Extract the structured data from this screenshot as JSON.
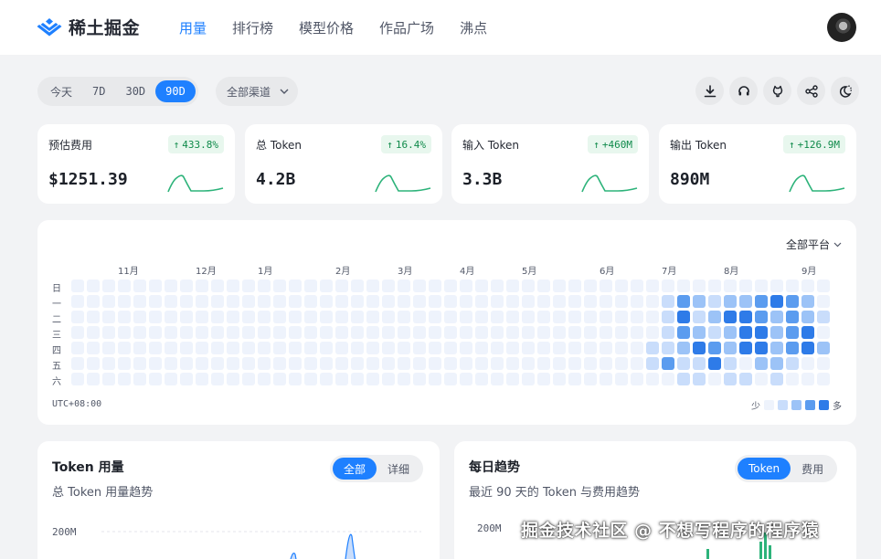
{
  "nav": {
    "brand": "稀土掘金",
    "links": [
      {
        "label": "用量",
        "active": true
      },
      {
        "label": "排行榜",
        "active": false
      },
      {
        "label": "模型价格",
        "active": false
      },
      {
        "label": "作品广场",
        "active": false
      },
      {
        "label": "沸点",
        "active": false
      }
    ],
    "accent_color": "#1e80ff"
  },
  "toolbar": {
    "ranges": [
      {
        "label": "今天",
        "active": false
      },
      {
        "label": "7D",
        "active": false
      },
      {
        "label": "30D",
        "active": false
      },
      {
        "label": "90D",
        "active": true
      }
    ],
    "channel_select": "全部渠道",
    "icons": [
      "download-icon",
      "headset-icon",
      "github-icon",
      "share-icon",
      "theme-toggle-icon"
    ]
  },
  "stats": [
    {
      "label": "预估费用",
      "change": "433.8%",
      "value": "$1251.39"
    },
    {
      "label": "总 Token",
      "change": "16.4%",
      "value": "4.2B"
    },
    {
      "label": "输入 Token",
      "change": "+460M",
      "value": "3.3B"
    },
    {
      "label": "输出 Token",
      "change": "+126.9M",
      "value": "890M"
    }
  ],
  "heatmap": {
    "platform_select": "全部平台",
    "months": [
      "11月",
      "12月",
      "1月",
      "2月",
      "3月",
      "4月",
      "5月",
      "6月",
      "7月",
      "8月",
      "9月"
    ],
    "weekdays": [
      "日",
      "一",
      "二",
      "三",
      "四",
      "五",
      "六"
    ],
    "timezone": "UTC+08:00",
    "legend_less": "少",
    "legend_more": "多",
    "level_colors": [
      "#eef3fc",
      "#c9ddfb",
      "#9cc3f7",
      "#5b9cef",
      "#2e7be8"
    ]
  },
  "token_usage": {
    "title": "Token 用量",
    "subtitle": "总 Token 用量趋势",
    "tabs": [
      {
        "label": "全部",
        "active": true
      },
      {
        "label": "详细",
        "active": false
      }
    ],
    "y_tick": "200M"
  },
  "daily_trend": {
    "title": "每日趋势",
    "subtitle": "最近 90 天的 Token 与费用趋势",
    "tabs": [
      {
        "label": "Token",
        "active": true
      },
      {
        "label": "费用",
        "active": false
      }
    ],
    "y_tick": "200M"
  },
  "watermark": "掘金技术社区 @ 不想写程序的程序猿"
}
